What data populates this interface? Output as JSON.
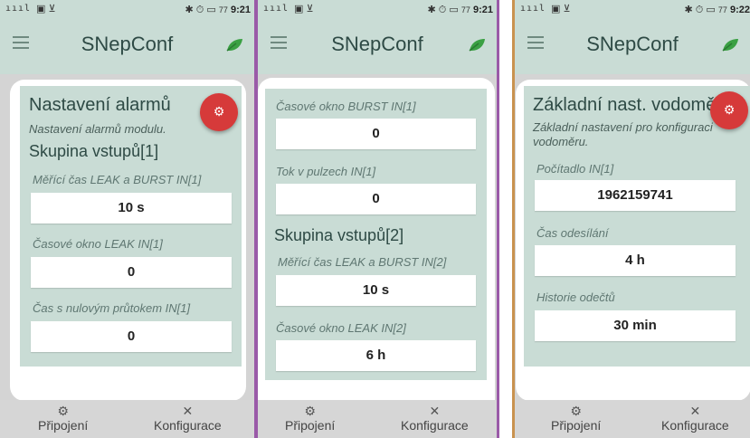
{
  "phones": [
    {
      "status": {
        "signal": "ıııl",
        "icons": "▣ ⊻",
        "right_icons": "✱ ⏱ ▭",
        "battery": "77",
        "time": "9:21"
      },
      "app_title": "SNepConf",
      "card": {
        "heading": "Nastavení alarmů",
        "subheading": "Nastavení alarmů modulu.",
        "group": "Skupina vstupů[1]",
        "fields": [
          {
            "label": "Měřící čas LEAK a BURST IN[1]",
            "value": "10 s"
          },
          {
            "label": "Časové okno LEAK IN[1]",
            "value": "0"
          },
          {
            "label": "Čas s nulovým průtokem IN[1]",
            "value": "0"
          }
        ]
      },
      "nav": [
        {
          "label": "Připojení",
          "icon": "gears-icon"
        },
        {
          "label": "Konfigurace",
          "icon": "tools-icon"
        }
      ]
    },
    {
      "status": {
        "signal": "ıııl",
        "icons": "▣ ⊻",
        "right_icons": "✱ ⏱ ▭",
        "battery": "77",
        "time": "9:21"
      },
      "app_title": "SNepConf",
      "card": {
        "fields_top": [
          {
            "label": "Časové okno BURST IN[1]",
            "value": "0"
          },
          {
            "label": "Tok v pulzech IN[1]",
            "value": "0"
          }
        ],
        "group": "Skupina vstupů[2]",
        "fields_bottom": [
          {
            "label": "Měřící čas LEAK a BURST IN[2]",
            "value": "10 s"
          },
          {
            "label": "Časové okno LEAK IN[2]",
            "value": "6 h"
          }
        ]
      },
      "nav": [
        {
          "label": "Připojení",
          "icon": "gears-icon"
        },
        {
          "label": "Konfigurace",
          "icon": "tools-icon"
        }
      ]
    },
    {
      "status": {
        "signal": "ıııl",
        "icons": "▣ ⊻",
        "right_icons": "✱ ⏱ ▭",
        "battery": "77",
        "time": "9:22"
      },
      "app_title": "SNepConf",
      "card": {
        "heading": "Základní nast. vodoměru",
        "subheading": "Základní nastavení pro konfiguraci vodoměru.",
        "fields": [
          {
            "label": "Počítadlo IN[1]",
            "value": "1962159741"
          },
          {
            "label": "Čas odesílání",
            "value": "4 h"
          },
          {
            "label": "Historie odečtů",
            "value": "30 min"
          }
        ]
      },
      "nav": [
        {
          "label": "Připojení",
          "icon": "gears-icon"
        },
        {
          "label": "Konfigurace",
          "icon": "tools-icon"
        }
      ]
    }
  ],
  "colors": {
    "accent_fab": "#d63a3a",
    "card_bg": "#c9dcd5",
    "frame_purple": "#9a5aa8",
    "frame_orange": "#c9924f"
  }
}
